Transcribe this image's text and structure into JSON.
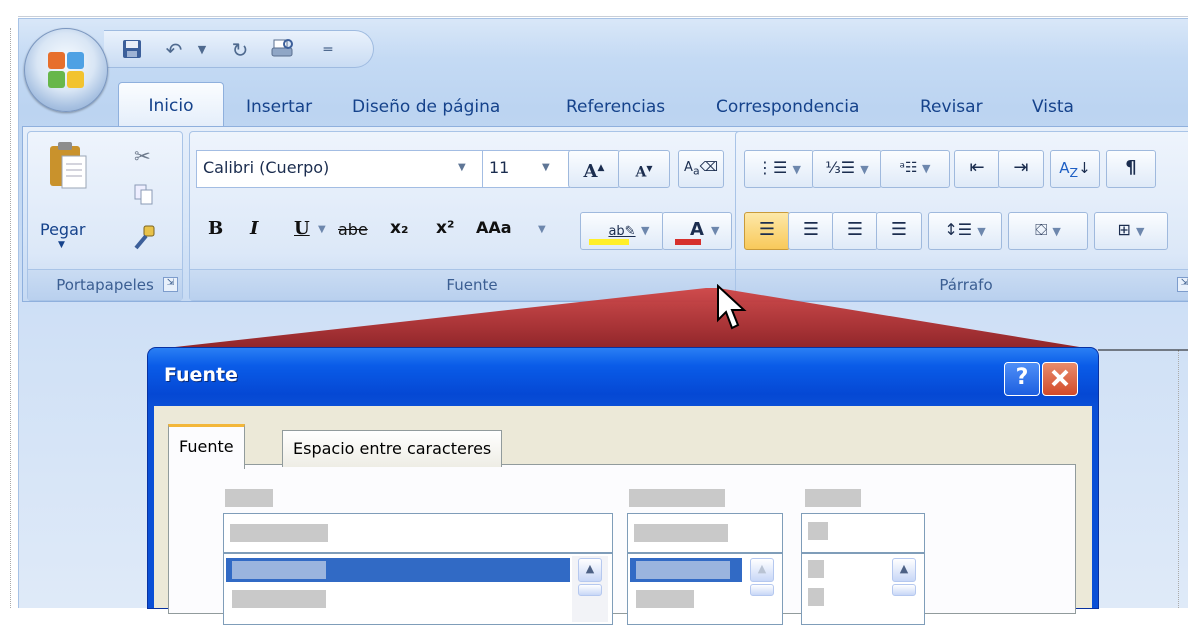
{
  "tabs": [
    "Inicio",
    "Insertar",
    "Diseño de página",
    "Referencias",
    "Correspondencia",
    "Revisar",
    "Vista"
  ],
  "clipboard": {
    "paste_label": "Pegar",
    "group_label": "Portapapeles"
  },
  "font_group": {
    "font_name": "Calibri (Cuerpo)",
    "font_size": "11",
    "group_label": "Fuente",
    "bold": "B",
    "italic": "I",
    "underline": "U",
    "strike": "abe",
    "subscript": "x₂",
    "superscript": "x²",
    "case": "Aa"
  },
  "paragraph_group": {
    "group_label": "Párrafo",
    "pilcrow": "¶"
  },
  "dialog": {
    "title": "Fuente",
    "help": "?",
    "close": "X",
    "tab_font": "Fuente",
    "tab_spacing": "Espacio entre caracteres"
  },
  "colors": {
    "title_bar": "#0a4fd6",
    "selection": "#316ac5",
    "funnel": "#b4282a"
  },
  "icons": [
    "office-button",
    "save-icon",
    "undo-icon",
    "redo-icon",
    "print-preview-icon",
    "qat-dropdown-icon",
    "paste-icon",
    "cut-icon",
    "copy-icon",
    "format-painter-icon",
    "grow-font-icon",
    "shrink-font-icon",
    "clear-format-icon",
    "highlight-icon",
    "font-color-icon",
    "bullets-icon",
    "numbering-icon",
    "multilevel-icon",
    "decrease-indent-icon",
    "increase-indent-icon",
    "sort-icon",
    "show-marks-icon",
    "align-left-icon",
    "center-icon",
    "align-right-icon",
    "justify-icon",
    "line-spacing-icon",
    "shading-icon",
    "borders-icon",
    "mouse-cursor-icon"
  ]
}
